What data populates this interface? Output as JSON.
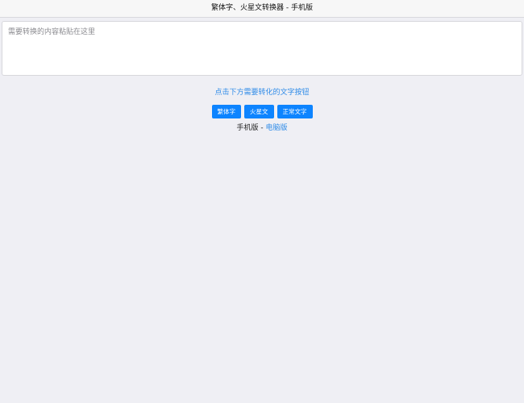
{
  "header": {
    "title": "繁体字、火星文转换器 - 手机版"
  },
  "editor": {
    "placeholder": "需要转换的内容粘贴在这里",
    "value": ""
  },
  "hint": {
    "text": "点击下方需要转化的文字按钮"
  },
  "buttons": {
    "traditional": "繁体字",
    "martian": "火星文",
    "normal": "正常文字"
  },
  "footer": {
    "mobile_label": "手机版",
    "separator": " - ",
    "desktop_link": "电脑版"
  },
  "colors": {
    "accent": "#0d84ff",
    "link": "#2f8be8",
    "background": "#efeff4"
  }
}
